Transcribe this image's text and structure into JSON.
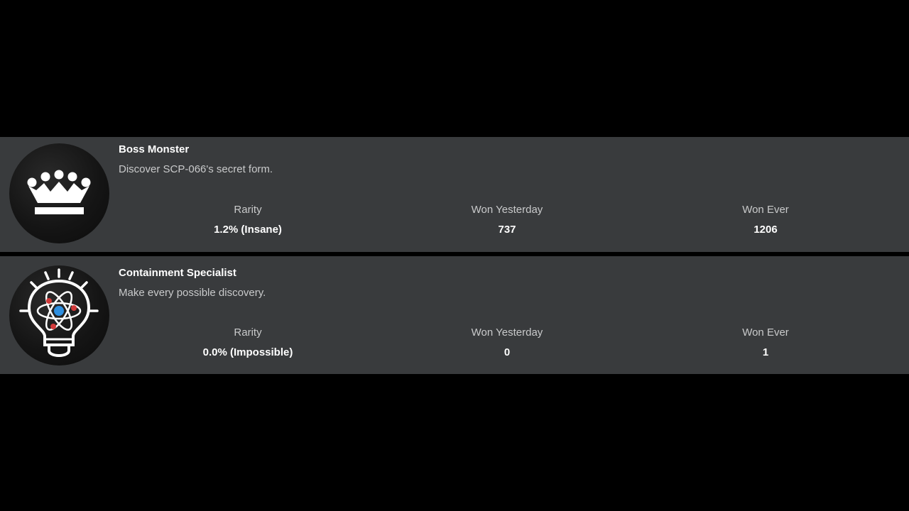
{
  "badges": [
    {
      "name": "Boss Monster",
      "description": "Discover SCP-066's secret form.",
      "icon": "crown-icon",
      "stats": {
        "rarity_label": "Rarity",
        "rarity_value": "1.2% (Insane)",
        "won_yesterday_label": "Won Yesterday",
        "won_yesterday_value": "737",
        "won_ever_label": "Won Ever",
        "won_ever_value": "1206"
      }
    },
    {
      "name": "Containment Specialist",
      "description": "Make every possible discovery.",
      "icon": "lightbulb-atom-icon",
      "stats": {
        "rarity_label": "Rarity",
        "rarity_value": "0.0% (Impossible)",
        "won_yesterday_label": "Won Yesterday",
        "won_yesterday_value": "0",
        "won_ever_label": "Won Ever",
        "won_ever_value": "1"
      }
    }
  ],
  "colors": {
    "page_background": "#000000",
    "row_background": "#393b3d",
    "title_text": "#ffffff",
    "secondary_text": "#c9cacb",
    "atom_nucleus": "#2e8fe0",
    "atom_electron": "#d23a3a"
  }
}
